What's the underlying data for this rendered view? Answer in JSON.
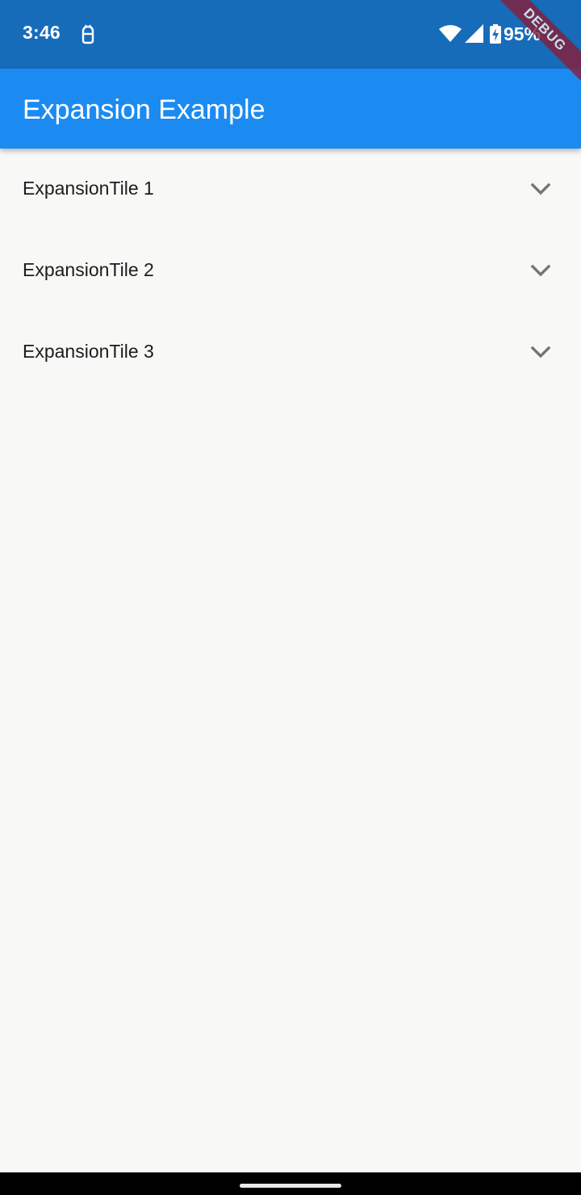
{
  "status_bar": {
    "time": "3:46",
    "battery_percent": "95%",
    "notification_icon": "android-debug-icon",
    "wifi_icon": "wifi-icon",
    "signal_icon": "cell-signal-icon",
    "battery_icon": "battery-charging-icon",
    "background_color": "#176cb9"
  },
  "debug_banner": {
    "label": "DEBUG",
    "color": "#8a1c35"
  },
  "app_bar": {
    "title": "Expansion Example",
    "background_color": "#1c8bf1"
  },
  "tiles": [
    {
      "title": "ExpansionTile 1",
      "icon": "chevron-down-icon",
      "expanded": false
    },
    {
      "title": "ExpansionTile 2",
      "icon": "chevron-down-icon",
      "expanded": false
    },
    {
      "title": "ExpansionTile 3",
      "icon": "chevron-down-icon",
      "expanded": false
    }
  ],
  "colors": {
    "page_background": "#f8f8f7",
    "tile_text": "#1c1c1c",
    "chevron": "#757575"
  }
}
